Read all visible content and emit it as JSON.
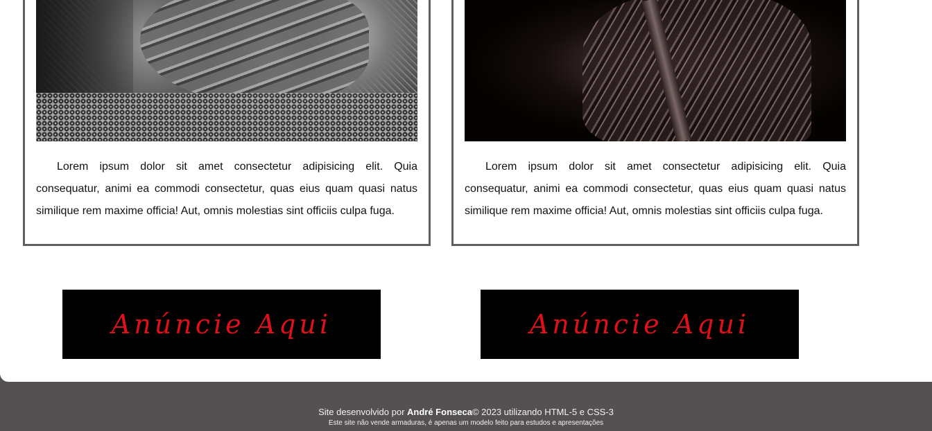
{
  "cards": [
    {
      "image_description_icon": "armor-photo",
      "text": "Lorem ipsum dolor sit amet consectetur adipisicing elit. Quia consequatur, animi ea commodi consectetur, quas eius quam quasi natus similique rem maxime officia! Aut, omnis molestias sint officiis culpa fuga."
    },
    {
      "image_description_icon": "armor-photo",
      "text": "Lorem ipsum dolor sit amet consectetur adipisicing elit. Quia consequatur, animi ea commodi consectetur, quas eius quam quasi natus similique rem maxime officia! Aut, omnis molestias sint officiis culpa fuga."
    }
  ],
  "ads": [
    {
      "label": "Anúncie Aqui"
    },
    {
      "label": "Anúncie Aqui"
    }
  ],
  "footer": {
    "prefix": "Site desenvolvido por ",
    "author": "André Fonseca",
    "suffix": "© 2023 utilizando HTML-5 e CSS-3",
    "disclaimer": "Este site não vende armaduras, é apenas um modelo feito para estudos e apresentações"
  },
  "colors": {
    "footer_bg": "#555152",
    "ad_text": "#e0101a",
    "card_border": "#5e5e5e"
  }
}
